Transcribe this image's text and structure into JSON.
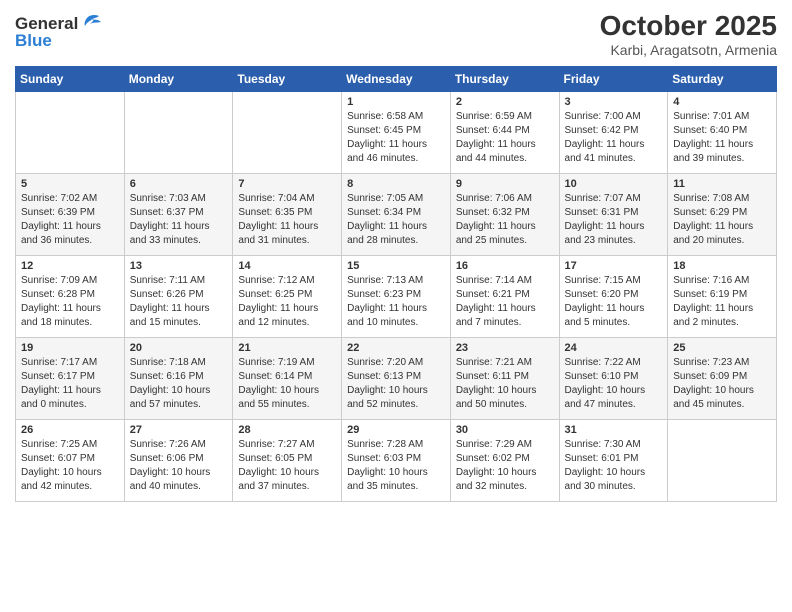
{
  "header": {
    "logo_general": "General",
    "logo_blue": "Blue",
    "month_title": "October 2025",
    "subtitle": "Karbi, Aragatsotn, Armenia"
  },
  "calendar": {
    "days_of_week": [
      "Sunday",
      "Monday",
      "Tuesday",
      "Wednesday",
      "Thursday",
      "Friday",
      "Saturday"
    ],
    "weeks": [
      [
        {
          "day": "",
          "info": ""
        },
        {
          "day": "",
          "info": ""
        },
        {
          "day": "",
          "info": ""
        },
        {
          "day": "1",
          "info": "Sunrise: 6:58 AM\nSunset: 6:45 PM\nDaylight: 11 hours and 46 minutes."
        },
        {
          "day": "2",
          "info": "Sunrise: 6:59 AM\nSunset: 6:44 PM\nDaylight: 11 hours and 44 minutes."
        },
        {
          "day": "3",
          "info": "Sunrise: 7:00 AM\nSunset: 6:42 PM\nDaylight: 11 hours and 41 minutes."
        },
        {
          "day": "4",
          "info": "Sunrise: 7:01 AM\nSunset: 6:40 PM\nDaylight: 11 hours and 39 minutes."
        }
      ],
      [
        {
          "day": "5",
          "info": "Sunrise: 7:02 AM\nSunset: 6:39 PM\nDaylight: 11 hours and 36 minutes."
        },
        {
          "day": "6",
          "info": "Sunrise: 7:03 AM\nSunset: 6:37 PM\nDaylight: 11 hours and 33 minutes."
        },
        {
          "day": "7",
          "info": "Sunrise: 7:04 AM\nSunset: 6:35 PM\nDaylight: 11 hours and 31 minutes."
        },
        {
          "day": "8",
          "info": "Sunrise: 7:05 AM\nSunset: 6:34 PM\nDaylight: 11 hours and 28 minutes."
        },
        {
          "day": "9",
          "info": "Sunrise: 7:06 AM\nSunset: 6:32 PM\nDaylight: 11 hours and 25 minutes."
        },
        {
          "day": "10",
          "info": "Sunrise: 7:07 AM\nSunset: 6:31 PM\nDaylight: 11 hours and 23 minutes."
        },
        {
          "day": "11",
          "info": "Sunrise: 7:08 AM\nSunset: 6:29 PM\nDaylight: 11 hours and 20 minutes."
        }
      ],
      [
        {
          "day": "12",
          "info": "Sunrise: 7:09 AM\nSunset: 6:28 PM\nDaylight: 11 hours and 18 minutes."
        },
        {
          "day": "13",
          "info": "Sunrise: 7:11 AM\nSunset: 6:26 PM\nDaylight: 11 hours and 15 minutes."
        },
        {
          "day": "14",
          "info": "Sunrise: 7:12 AM\nSunset: 6:25 PM\nDaylight: 11 hours and 12 minutes."
        },
        {
          "day": "15",
          "info": "Sunrise: 7:13 AM\nSunset: 6:23 PM\nDaylight: 11 hours and 10 minutes."
        },
        {
          "day": "16",
          "info": "Sunrise: 7:14 AM\nSunset: 6:21 PM\nDaylight: 11 hours and 7 minutes."
        },
        {
          "day": "17",
          "info": "Sunrise: 7:15 AM\nSunset: 6:20 PM\nDaylight: 11 hours and 5 minutes."
        },
        {
          "day": "18",
          "info": "Sunrise: 7:16 AM\nSunset: 6:19 PM\nDaylight: 11 hours and 2 minutes."
        }
      ],
      [
        {
          "day": "19",
          "info": "Sunrise: 7:17 AM\nSunset: 6:17 PM\nDaylight: 11 hours and 0 minutes."
        },
        {
          "day": "20",
          "info": "Sunrise: 7:18 AM\nSunset: 6:16 PM\nDaylight: 10 hours and 57 minutes."
        },
        {
          "day": "21",
          "info": "Sunrise: 7:19 AM\nSunset: 6:14 PM\nDaylight: 10 hours and 55 minutes."
        },
        {
          "day": "22",
          "info": "Sunrise: 7:20 AM\nSunset: 6:13 PM\nDaylight: 10 hours and 52 minutes."
        },
        {
          "day": "23",
          "info": "Sunrise: 7:21 AM\nSunset: 6:11 PM\nDaylight: 10 hours and 50 minutes."
        },
        {
          "day": "24",
          "info": "Sunrise: 7:22 AM\nSunset: 6:10 PM\nDaylight: 10 hours and 47 minutes."
        },
        {
          "day": "25",
          "info": "Sunrise: 7:23 AM\nSunset: 6:09 PM\nDaylight: 10 hours and 45 minutes."
        }
      ],
      [
        {
          "day": "26",
          "info": "Sunrise: 7:25 AM\nSunset: 6:07 PM\nDaylight: 10 hours and 42 minutes."
        },
        {
          "day": "27",
          "info": "Sunrise: 7:26 AM\nSunset: 6:06 PM\nDaylight: 10 hours and 40 minutes."
        },
        {
          "day": "28",
          "info": "Sunrise: 7:27 AM\nSunset: 6:05 PM\nDaylight: 10 hours and 37 minutes."
        },
        {
          "day": "29",
          "info": "Sunrise: 7:28 AM\nSunset: 6:03 PM\nDaylight: 10 hours and 35 minutes."
        },
        {
          "day": "30",
          "info": "Sunrise: 7:29 AM\nSunset: 6:02 PM\nDaylight: 10 hours and 32 minutes."
        },
        {
          "day": "31",
          "info": "Sunrise: 7:30 AM\nSunset: 6:01 PM\nDaylight: 10 hours and 30 minutes."
        },
        {
          "day": "",
          "info": ""
        }
      ]
    ]
  }
}
